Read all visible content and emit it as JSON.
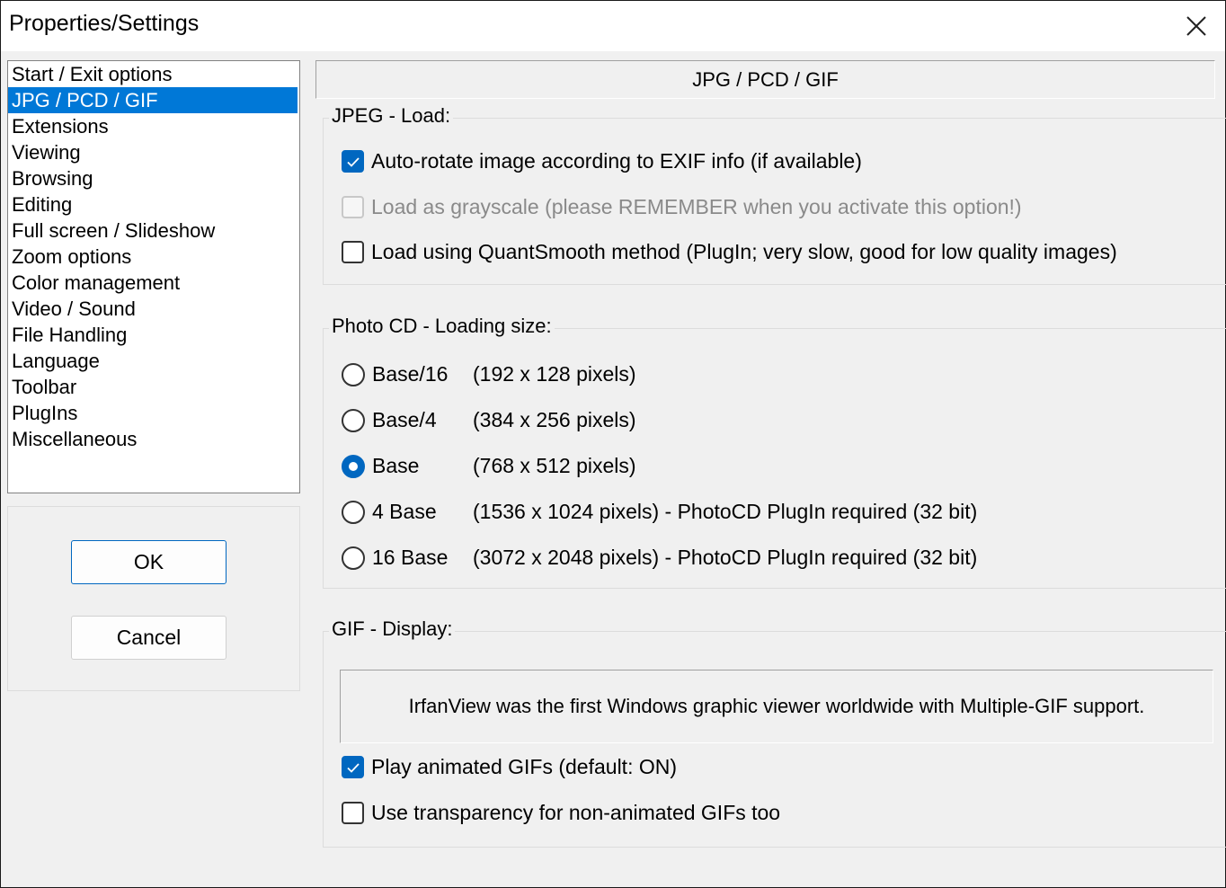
{
  "window": {
    "title": "Properties/Settings",
    "close_icon": "close-icon"
  },
  "categories": [
    {
      "label": "Start / Exit options",
      "selected": false
    },
    {
      "label": "JPG / PCD / GIF",
      "selected": true
    },
    {
      "label": "Extensions",
      "selected": false
    },
    {
      "label": "Viewing",
      "selected": false
    },
    {
      "label": "Browsing",
      "selected": false
    },
    {
      "label": "Editing",
      "selected": false
    },
    {
      "label": "Full screen / Slideshow",
      "selected": false
    },
    {
      "label": "Zoom options",
      "selected": false
    },
    {
      "label": "Color management",
      "selected": false
    },
    {
      "label": "Video / Sound",
      "selected": false
    },
    {
      "label": "File Handling",
      "selected": false
    },
    {
      "label": "Language",
      "selected": false
    },
    {
      "label": "Toolbar",
      "selected": false
    },
    {
      "label": "PlugIns",
      "selected": false
    },
    {
      "label": "Miscellaneous",
      "selected": false
    }
  ],
  "buttons": {
    "ok": "OK",
    "cancel": "Cancel"
  },
  "page": {
    "header": "JPG / PCD / GIF",
    "jpeg": {
      "legend": "JPEG - Load:",
      "options": [
        {
          "label": "Auto-rotate image according to EXIF info (if available)",
          "checked": true,
          "enabled": true
        },
        {
          "label": "Load as grayscale (please REMEMBER when you activate this option!)",
          "checked": false,
          "enabled": false
        },
        {
          "label": "Load using QuantSmooth method (PlugIn; very slow, good for low quality images)",
          "checked": false,
          "enabled": true
        }
      ]
    },
    "photocd": {
      "legend": "Photo CD - Loading size:",
      "selected_index": 2,
      "options": [
        {
          "label": "Base/16",
          "desc": "(192 x 128 pixels)"
        },
        {
          "label": "Base/4",
          "desc": "(384 x 256 pixels)"
        },
        {
          "label": "Base",
          "desc": "(768 x 512 pixels)"
        },
        {
          "label": "4 Base",
          "desc": "(1536 x 1024 pixels) - PhotoCD PlugIn required (32 bit)"
        },
        {
          "label": "16 Base",
          "desc": "(3072 x 2048 pixels) - PhotoCD PlugIn required (32 bit)"
        }
      ]
    },
    "gif": {
      "legend": "GIF - Display:",
      "info": "IrfanView was the first Windows graphic viewer worldwide with Multiple-GIF support.",
      "options": [
        {
          "label": "Play animated GIFs (default: ON)",
          "checked": true,
          "enabled": true
        },
        {
          "label": "Use transparency for non-animated GIFs too",
          "checked": false,
          "enabled": true
        }
      ]
    }
  },
  "colors": {
    "accent": "#0067c0",
    "selection": "#0078d7",
    "dialog_bg": "#f0f0f0"
  }
}
